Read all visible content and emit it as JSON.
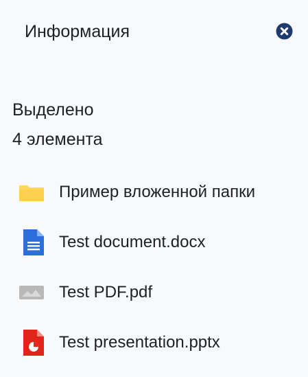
{
  "panel": {
    "title": "Информация",
    "close_icon": "close-circle-icon"
  },
  "selection": {
    "label": "Выделено",
    "count_text": "4 элемента"
  },
  "files": [
    {
      "name": "Пример вложенной папки",
      "icon": "folder-icon",
      "color": "#ffd760"
    },
    {
      "name": "Test document.docx",
      "icon": "docs-icon",
      "color": "#2a6fdb"
    },
    {
      "name": "Test PDF.pdf",
      "icon": "image-file-icon",
      "color": "#b8b8b8"
    },
    {
      "name": "Test presentation.pptx",
      "icon": "presentation-icon",
      "color": "#e1251b"
    }
  ],
  "colors": {
    "panel_bg": "#f8f9fa",
    "close_icon": "#1e3a6e"
  }
}
